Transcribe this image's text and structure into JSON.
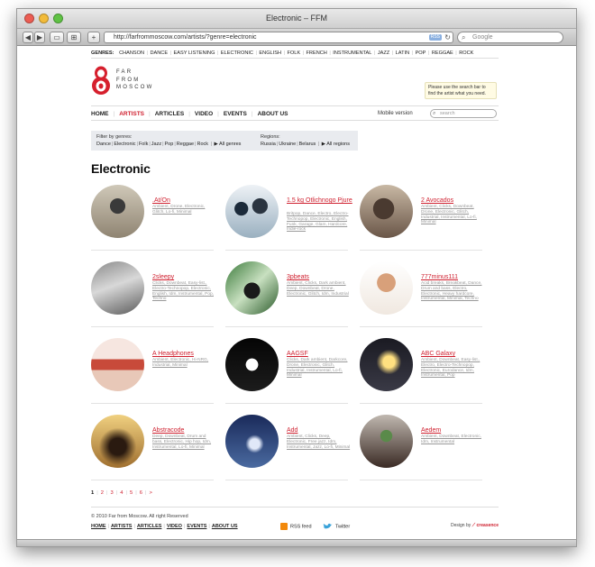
{
  "window": {
    "title": "Electronic – FFM"
  },
  "browser": {
    "url": "http://farfrommoscow.com/artists/?genre=electronic",
    "rss_badge": "RSS",
    "search_placeholder": "Google"
  },
  "genres": {
    "label": "GENRES:",
    "items": [
      "CHANSON",
      "DANCE",
      "EASY LISTENING",
      "ELECTRONIC",
      "ENGLISH",
      "FOLK",
      "FRENCH",
      "INSTRUMENTAL",
      "JAZZ",
      "LATIN",
      "POP",
      "REGGAE",
      "ROCK"
    ]
  },
  "logo": {
    "lines": [
      "FAR",
      "FROM",
      "MOSCOW"
    ]
  },
  "tooltip": "Please use the search bar to find the artist what you need.",
  "nav": {
    "items": [
      "HOME",
      "ARTISTS",
      "ARTICLES",
      "VIDEO",
      "EVENTS",
      "ABOUT US"
    ],
    "active": "ARTISTS",
    "mobile": "Mobile version",
    "search_placeholder": "search"
  },
  "filter": {
    "genres_title": "Filter by genres:",
    "genres": [
      "Dance",
      "Electronic",
      "Folk",
      "Jazz",
      "Pop",
      "Reggae",
      "Rock"
    ],
    "all_genres": "All genres",
    "regions_title": "Regions:",
    "regions": [
      "Russia",
      "Ukraine",
      "Belarus"
    ],
    "all_regions": "All regions"
  },
  "heading": "Electronic",
  "artists": [
    {
      "name": ".At/On",
      "tags": "Ambient, Drone, Electronic, Glitch, Lo-fi, Minimal"
    },
    {
      "name": "1.5 kg Otlichnogo Pjure",
      "tags": "Britpop, Dance, Electro, Electro-Technopop, Electronic, English, Funk, Garage, Glam, Hardcore, Indie-rock"
    },
    {
      "name": "2 Avocados",
      "tags": "Ambient, Clicks, Downbeat, Drone, Electronic, Glitch, Industrial, Instrumental, Lo-fi, Minimal"
    },
    {
      "name": "2sleepy",
      "tags": "Clicks, Downbeat, Easy-list., Electro-Technopop, Electronic, English, Idm, Instrumental, Pop, Techno"
    },
    {
      "name": "3pbeats",
      "tags": "Ambient, Clicks, Dark ambient, Deep, Downbeat, Drone, Electronic, Glitch, Idm, Industrial"
    },
    {
      "name": "777minus111",
      "tags": "Acid breaks, Breakbeat, Dance, Drum and bass, Electro, Electronic, Heavy hardcore, Instrumental, Minimal, Techno"
    },
    {
      "name": "A Headphones",
      "tags": "Ambient, Electronic, Hi-NRG, Industrial, Minimal"
    },
    {
      "name": "AAGSF",
      "tags": "Clicks, Dark ambient, Darkcore, Drone, Electronic, Glitch, Industrial, Instrumental, Lo-fi, Minimal"
    },
    {
      "name": "ABC Galaxy",
      "tags": "Ambient, Downbeat, Easy-list., Electro, Electro-Technopop, Electronic, Eurodance, Idm, Instrumental, Pop"
    },
    {
      "name": "Abstracode",
      "tags": "Deep, Downbeat, Drum and bass, Electronic, Hip hop, Idm, Instrumental, Lo-fi, Minimal"
    },
    {
      "name": "Add",
      "tags": "Ambient, Clicks, Deep, Electronic, Free jazz, Idm, Instrumental, Jazz, Lo-fi, Minimal"
    },
    {
      "name": "Aedem",
      "tags": "Ambient, Downbeat, Electronic, Idm, Instrumental"
    }
  ],
  "pager": {
    "current": "1",
    "pages": [
      "2",
      "3",
      "4",
      "5",
      "6"
    ],
    "next": ">"
  },
  "footer": {
    "copyright": "© 2010 Far from Moscow. All right Reserved",
    "nav": [
      "HOME",
      "ARTISTS",
      "ARTICLES",
      "VIDEO",
      "EVENTS",
      "ABOUT US"
    ],
    "rss": "RSS feed",
    "twitter": "Twitter",
    "design_label": "Design by",
    "design_brand": "creasence"
  },
  "colors": {
    "accent": "#cf1f2e",
    "filter_bg": "#e9ebef",
    "tooltip_bg": "#fffbe4"
  }
}
